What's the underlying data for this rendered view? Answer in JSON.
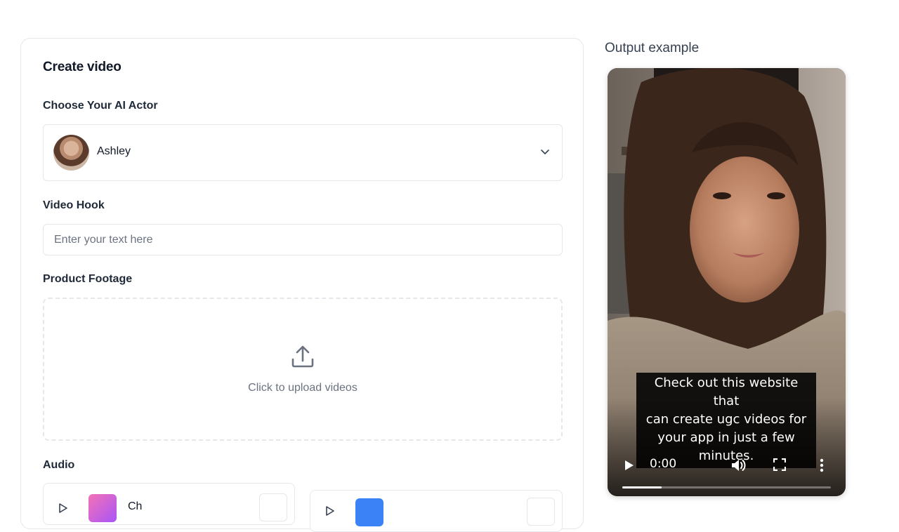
{
  "create": {
    "title": "Create video",
    "actor_label": "Choose Your AI Actor",
    "actor_name": "Ashley",
    "hook_label": "Video Hook",
    "hook_placeholder": "Enter your text here",
    "hook_value": "",
    "footage_label": "Product Footage",
    "upload_text": "Click to upload videos",
    "audio_label": "Audio",
    "audio_items": [
      {
        "name": "Ch",
        "swatch": "#d46bdb"
      },
      {
        "name": "",
        "swatch": "#3b82f6"
      }
    ]
  },
  "output": {
    "title": "Output example",
    "subtitle_lines": [
      "Check out this website that",
      "can create ugc videos for",
      "your app in just a few",
      "minutes."
    ],
    "time": "0:00",
    "progress": 0.19
  },
  "icons": {
    "chevron": "chevron-down-icon",
    "upload": "upload-icon",
    "play": "play-icon",
    "volume": "volume-icon",
    "fullscreen": "fullscreen-icon",
    "more": "more-vertical-icon"
  }
}
